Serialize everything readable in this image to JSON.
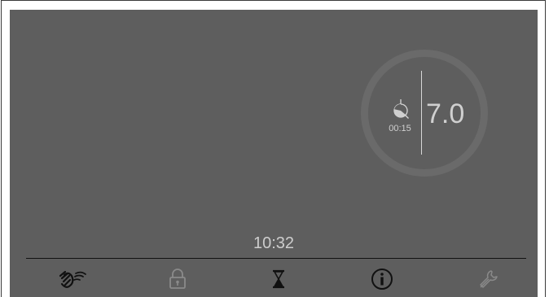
{
  "display": {
    "program_value": "7.0",
    "timer_remaining": "00:15",
    "clock": "10:32"
  },
  "toolbar": {
    "items": [
      {
        "icon": "hand-wave-icon",
        "active": true
      },
      {
        "icon": "lock-icon",
        "active": false
      },
      {
        "icon": "hourglass-icon",
        "active": true
      },
      {
        "icon": "info-icon",
        "active": true
      },
      {
        "icon": "wrench-icon",
        "active": false
      }
    ]
  },
  "colors": {
    "screen_bg": "#5e5e5e",
    "ring": "#6a6a6a",
    "text_light": "#cdcdcd",
    "icon_active": "#111111",
    "icon_inactive": "#8a8a8a"
  }
}
